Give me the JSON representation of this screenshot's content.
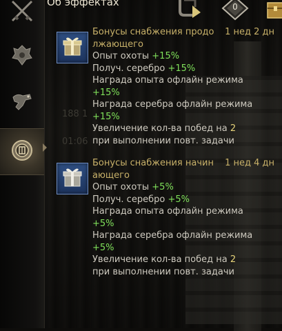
{
  "header": {
    "title": "Об эффектах",
    "counter_value": "0"
  },
  "background": {
    "ghost_text_1": "188 1",
    "ghost_text_2": "01:06"
  },
  "effects": [
    {
      "title": "Бонусы снабжения продолжающего",
      "title_line1": "Бонусы снабжения продо",
      "title_line2": "лжающего",
      "duration": "1 нед 2 дн",
      "hunt_label": "Опыт охоты",
      "hunt_value": "+15%",
      "silver_label": "Получ. серебро",
      "silver_value": "+15%",
      "offline_exp_label": "Награда опыта офлайн режима",
      "offline_exp_value": "+15%",
      "offline_silver_label": "Награда серебра офлайн режима",
      "offline_silver_value": "+15%",
      "wins_label": "Увеличение кол-ва побед на",
      "wins_value": "2",
      "wins_suffix": "при выполнении повт. задачи"
    },
    {
      "title": "Бонусы снабжения начинающего",
      "title_line1": "Бонусы снабжения начин",
      "title_line2": "ающего",
      "duration": "1 нед 4 дн",
      "hunt_label": "Опыт охоты",
      "hunt_value": "+5%",
      "silver_label": "Получ. серебро",
      "silver_value": "+5%",
      "offline_exp_label": "Награда опыта офлайн режима",
      "offline_exp_value": "+5%",
      "offline_silver_label": "Награда серебра офлайн режима",
      "offline_silver_value": "+5%",
      "wins_label": "Увеличение кол-ва побед на",
      "wins_value": "2",
      "wins_suffix": "при выполнении повт. задачи"
    }
  ],
  "sidebar": {
    "items": [
      {
        "icon": "crossed-swords-icon"
      },
      {
        "icon": "beast-emblem-icon"
      },
      {
        "icon": "mount-icon"
      },
      {
        "icon": "effects-emblem-icon",
        "active": true
      }
    ]
  },
  "colors": {
    "title_gold": "#c8b169",
    "value_green": "#7fe05a",
    "value_yellow": "#e6d37a",
    "text": "#cfcbc0",
    "icon_blue": "#2f4f82"
  }
}
